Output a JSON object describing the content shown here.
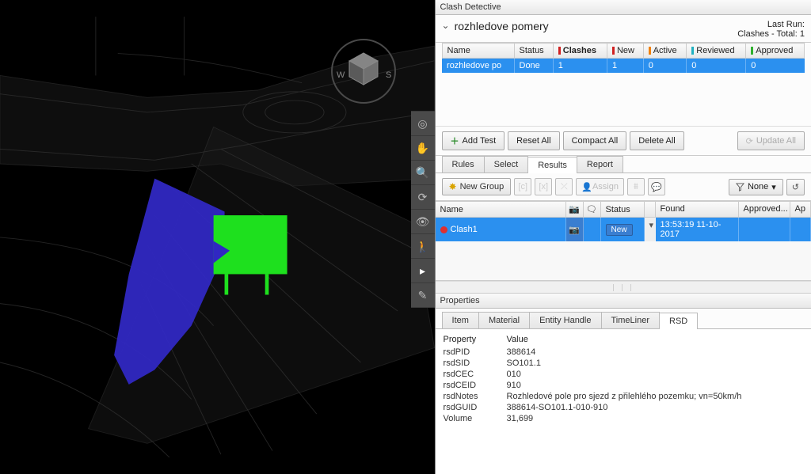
{
  "panelTitle": "Clash Detective",
  "accordion": {
    "title": "rozhledove pomery",
    "lastRunLabel": "Last Run:",
    "clashTotalLabel": "Clashes - Total: 1"
  },
  "tests": {
    "headers": {
      "name": "Name",
      "status": "Status",
      "clashes": "Clashes",
      "new": "New",
      "active": "Active",
      "reviewed": "Reviewed",
      "approved": "Approved"
    },
    "row": {
      "name": "rozhledove po",
      "status": "Done",
      "clashes": "1",
      "new": "1",
      "active": "0",
      "reviewed": "0",
      "approved": "0"
    }
  },
  "testsToolbar": {
    "addTest": "Add Test",
    "resetAll": "Reset All",
    "compactAll": "Compact All",
    "deleteAll": "Delete All",
    "updateAll": "Update All"
  },
  "mainTabs": {
    "rules": "Rules",
    "select": "Select",
    "results": "Results",
    "report": "Report"
  },
  "resultsBar": {
    "newGroup": "New Group",
    "assign": "Assign",
    "none": "None"
  },
  "resultsTable": {
    "headers": {
      "name": "Name",
      "status": "Status",
      "found": "Found",
      "approved": "Approved...",
      "ap": "Ap"
    },
    "row": {
      "name": "Clash1",
      "status": "New",
      "found": "13:53:19 11-10-2017"
    }
  },
  "propertiesTitle": "Properties",
  "propTabs": {
    "item": "Item",
    "material": "Material",
    "entity": "Entity Handle",
    "timeliner": "TimeLiner",
    "rsd": "RSD"
  },
  "propHeaders": {
    "property": "Property",
    "value": "Value"
  },
  "props": [
    {
      "k": "rsdPID",
      "v": "388614"
    },
    {
      "k": "rsdSID",
      "v": "SO101.1"
    },
    {
      "k": "rsdCEC",
      "v": "010"
    },
    {
      "k": "rsdCEID",
      "v": "910"
    },
    {
      "k": "rsdNotes",
      "v": "Rozhledové pole pro sjezd z přilehlého pozemku; vn=50km/h"
    },
    {
      "k": "rsdGUID",
      "v": "388614-SO101.1-010-910"
    },
    {
      "k": "Volume",
      "v": "31,699"
    }
  ]
}
